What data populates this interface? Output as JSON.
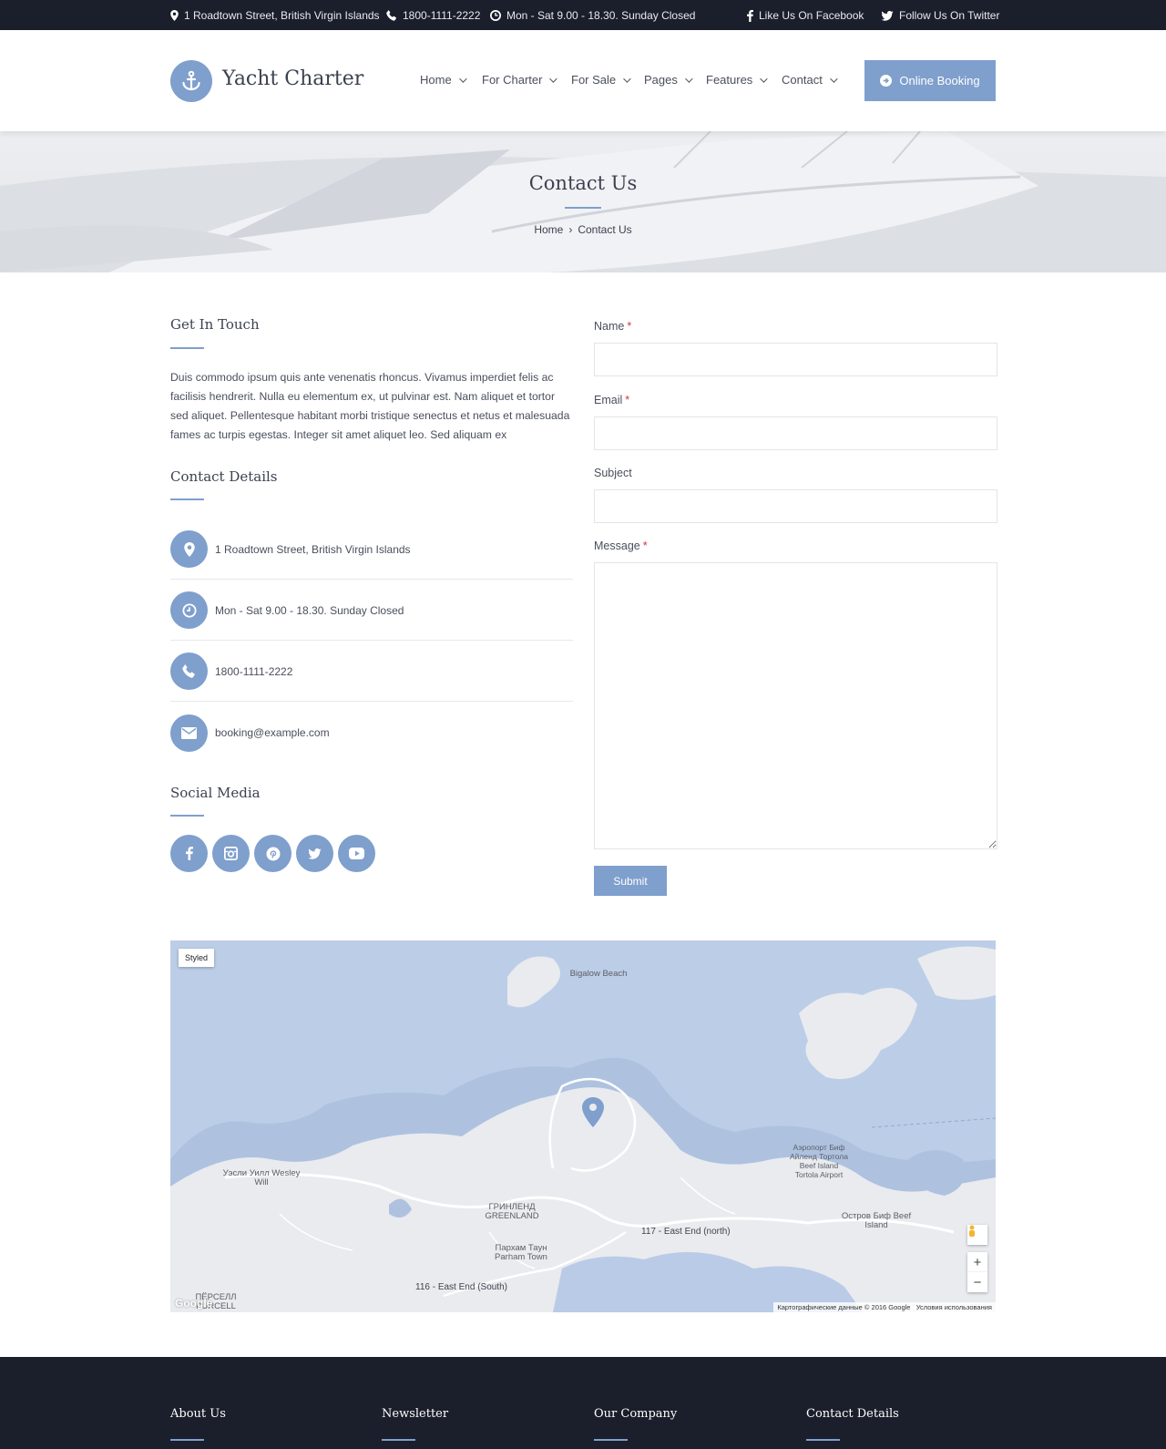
{
  "topbar": {
    "address": "1 Roadtown Street, British Virgin Islands",
    "phone": "1800-1111-2222",
    "hours": "Mon - Sat 9.00 - 18.30. Sunday Closed",
    "facebook": "Like Us On Facebook",
    "twitter": "Follow Us On Twitter"
  },
  "header": {
    "brand": "Yacht Charter",
    "nav": [
      "Home",
      "For Charter",
      "For Sale",
      "Pages",
      "Features",
      "Contact"
    ],
    "booking_label": "Online Booking"
  },
  "hero": {
    "title": "Contact Us",
    "breadcrumb": [
      "Home",
      "Contact Us"
    ]
  },
  "get_in_touch": {
    "title": "Get In Touch",
    "text": "Duis commodo ipsum quis ante venenatis rhoncus. Vivamus imperdiet felis ac facilisis hendrerit. Nulla eu elementum ex, ut pulvinar est. Nam aliquet et tortor sed aliquet. Pellentesque habitant morbi tristique senectus et netus et malesuada fames ac turpis egestas. Integer sit amet aliquet leo. Sed aliquam ex"
  },
  "contact_details": {
    "title": "Contact Details",
    "items": [
      {
        "icon": "map-pin-icon",
        "text": "1 Roadtown Street, British Virgin Islands"
      },
      {
        "icon": "clock-icon",
        "text": "Mon - Sat 9.00 - 18.30. Sunday Closed"
      },
      {
        "icon": "phone-icon",
        "text": "1800-1111-2222"
      },
      {
        "icon": "envelope-icon",
        "text": "booking@example.com"
      }
    ]
  },
  "social_media": {
    "title": "Social Media",
    "icons": [
      "facebook-icon",
      "instagram-icon",
      "pinterest-icon",
      "twitter-icon",
      "youtube-icon"
    ]
  },
  "form": {
    "name_label": "Name",
    "email_label": "Email",
    "subject_label": "Subject",
    "message_label": "Message",
    "required_mark": "*",
    "name_value": "",
    "email_value": "",
    "subject_value": "",
    "message_value": "",
    "submit_label": "Submit"
  },
  "map": {
    "style_button": "Styled",
    "labels": {
      "bigalow": "Bigalow Beach",
      "wesley": "Уэсли Уилл Wesley Will",
      "greenland": "ГРИНЛЕНД GREENLAND",
      "parham": "Пархам Таун Parham Town",
      "airport": "Аэропорт Биф Айленд Тортола Beef Island Tortola Airport",
      "beef_island": "Остров Биф Beef Island",
      "purcell": "ПЁРСЕЛЛ PURCELL",
      "road_north": "117 - East End (north)",
      "road_south": "116 - East End (South)"
    },
    "zoom_in": "+",
    "zoom_out": "−",
    "attribution": "Картографические данные © 2016 Google",
    "terms": "Условия использования",
    "google": "Google"
  },
  "footer": {
    "columns": [
      "About Us",
      "Newsletter",
      "Our Company",
      "Contact Details"
    ]
  },
  "colors": {
    "accent": "#7f9fcd",
    "dark": "#1b1e2b",
    "water": "#bccee7",
    "land": "#e9ebef"
  }
}
